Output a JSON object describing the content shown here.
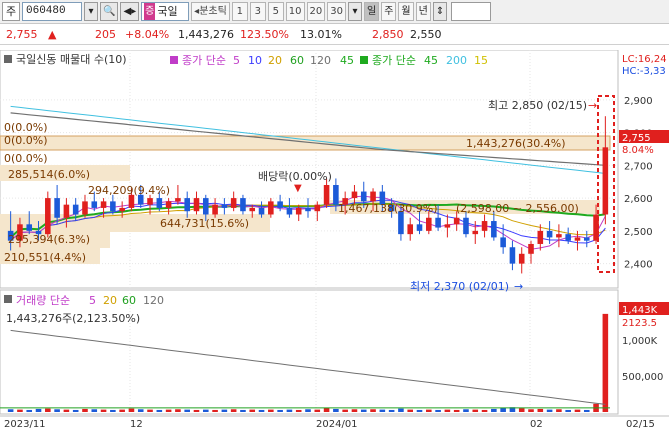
{
  "toolbar": {
    "market_label": "주",
    "stock_code": "060480",
    "stock_mark": "증",
    "stock_name": "국일",
    "menu_label": "◂분초틱",
    "intervals": [
      "1",
      "3",
      "5",
      "10",
      "20",
      "30"
    ],
    "selected_interval": "30",
    "periods": [
      "일",
      "주",
      "월",
      "년"
    ],
    "selected_period": "일"
  },
  "quote": {
    "price": "2,755",
    "change_arrow": "▲",
    "change": "205",
    "change_pct": "+8.04%",
    "volume": "1,443,276",
    "volume_ratio": "123.50%",
    "turnover": "13.01%",
    "high": "2,850",
    "open": "2,550"
  },
  "chart": {
    "legend_main_name": "국일신동 매물대 수(10)",
    "legend_ma_label": "종가 단순",
    "legend_ma_periods": [
      "5",
      "10",
      "20",
      "60",
      "120"
    ],
    "legend_ma2_label": "종가 단순",
    "legend_ma2_periods": [
      "45",
      "200",
      "15"
    ],
    "lc_label": "LC:16,24",
    "hc_label": "HC:-3,33",
    "y_ticks": [
      "2,900",
      "2,800",
      "2,700",
      "2,600",
      "2,500",
      "2,400"
    ],
    "last_price_box": "2,755",
    "last_pct_box": "8.04%",
    "vp_labels": [
      "0(0.0%)",
      "0(0.0%)",
      "0(0.0%)",
      "285,514(6.0%)",
      "294,209(9.4%)",
      "644,731(15.6%)",
      "295,394(6.3%)",
      "210,551(4.4%)",
      "1,443,276(30.4%)",
      "1,467,138(30.9%)"
    ],
    "range_label": "(2,598.00 ~ 2,556.00)",
    "dividend_label": "배당락(0.00%)",
    "high_label": "최고 2,850 (02/15)",
    "low_label": "최저 2,370 (02/01)",
    "volume_legend_label": "거래량 단순",
    "volume_legend_periods": [
      "5",
      "20",
      "60",
      "120"
    ],
    "volume_text": "1,443,276주(2,123.50%)",
    "volume_y_ticks": [
      "1,000K",
      "500,000"
    ],
    "volume_box": "1,443K",
    "volume_pct_box": "2123.5",
    "x_labels": [
      "2023/11",
      "12",
      "2024/01",
      "02",
      "02/15"
    ]
  },
  "chart_data": {
    "type": "candlestick",
    "y_range": [
      2350,
      2930
    ],
    "candles": [
      [
        2500,
        2560,
        2440,
        2470
      ],
      [
        2470,
        2540,
        2450,
        2520
      ],
      [
        2520,
        2560,
        2490,
        2500
      ],
      [
        2500,
        2530,
        2470,
        2490
      ],
      [
        2490,
        2620,
        2480,
        2600
      ],
      [
        2600,
        2640,
        2520,
        2540
      ],
      [
        2540,
        2600,
        2510,
        2580
      ],
      [
        2580,
        2600,
        2530,
        2550
      ],
      [
        2550,
        2610,
        2540,
        2590
      ],
      [
        2590,
        2620,
        2560,
        2570
      ],
      [
        2570,
        2600,
        2540,
        2590
      ],
      [
        2590,
        2610,
        2550,
        2560
      ],
      [
        2560,
        2590,
        2540,
        2570
      ],
      [
        2570,
        2630,
        2560,
        2610
      ],
      [
        2610,
        2640,
        2570,
        2580
      ],
      [
        2580,
        2610,
        2550,
        2600
      ],
      [
        2600,
        2620,
        2560,
        2570
      ],
      [
        2570,
        2600,
        2550,
        2590
      ],
      [
        2590,
        2640,
        2580,
        2600
      ],
      [
        2600,
        2620,
        2540,
        2560
      ],
      [
        2560,
        2620,
        2550,
        2600
      ],
      [
        2600,
        2610,
        2530,
        2550
      ],
      [
        2550,
        2600,
        2540,
        2580
      ],
      [
        2580,
        2600,
        2550,
        2570
      ],
      [
        2570,
        2620,
        2560,
        2600
      ],
      [
        2600,
        2610,
        2550,
        2560
      ],
      [
        2560,
        2580,
        2540,
        2570
      ],
      [
        2570,
        2590,
        2540,
        2550
      ],
      [
        2550,
        2600,
        2540,
        2590
      ],
      [
        2590,
        2610,
        2560,
        2570
      ],
      [
        2570,
        2600,
        2540,
        2550
      ],
      [
        2550,
        2580,
        2530,
        2570
      ],
      [
        2570,
        2600,
        2540,
        2560
      ],
      [
        2560,
        2590,
        2530,
        2580
      ],
      [
        2580,
        2660,
        2570,
        2640
      ],
      [
        2640,
        2660,
        2560,
        2580
      ],
      [
        2580,
        2620,
        2550,
        2600
      ],
      [
        2600,
        2640,
        2580,
        2620
      ],
      [
        2620,
        2650,
        2570,
        2590
      ],
      [
        2590,
        2630,
        2560,
        2620
      ],
      [
        2620,
        2640,
        2560,
        2580
      ],
      [
        2580,
        2600,
        2540,
        2560
      ],
      [
        2560,
        2580,
        2470,
        2490
      ],
      [
        2490,
        2540,
        2470,
        2520
      ],
      [
        2520,
        2560,
        2490,
        2500
      ],
      [
        2500,
        2560,
        2490,
        2540
      ],
      [
        2540,
        2580,
        2500,
        2510
      ],
      [
        2510,
        2550,
        2480,
        2520
      ],
      [
        2520,
        2560,
        2500,
        2540
      ],
      [
        2540,
        2560,
        2480,
        2490
      ],
      [
        2490,
        2530,
        2460,
        2500
      ],
      [
        2500,
        2550,
        2480,
        2530
      ],
      [
        2530,
        2560,
        2470,
        2480
      ],
      [
        2480,
        2520,
        2430,
        2450
      ],
      [
        2450,
        2470,
        2380,
        2400
      ],
      [
        2400,
        2450,
        2370,
        2430
      ],
      [
        2430,
        2470,
        2400,
        2460
      ],
      [
        2460,
        2520,
        2440,
        2500
      ],
      [
        2500,
        2530,
        2460,
        2480
      ],
      [
        2480,
        2520,
        2450,
        2490
      ],
      [
        2490,
        2510,
        2460,
        2470
      ],
      [
        2470,
        2500,
        2440,
        2480
      ],
      [
        2480,
        2500,
        2450,
        2470
      ],
      [
        2470,
        2580,
        2460,
        2550
      ],
      [
        2550,
        2850,
        2520,
        2755
      ]
    ],
    "volume_range": [
      0,
      1500000
    ],
    "volumes": [
      40,
      35,
      30,
      45,
      50,
      40,
      35,
      30,
      45,
      40,
      35,
      30,
      35,
      50,
      40,
      35,
      30,
      35,
      40,
      35,
      30,
      35,
      30,
      35,
      40,
      30,
      35,
      30,
      35,
      30,
      35,
      30,
      40,
      35,
      60,
      45,
      35,
      40,
      35,
      40,
      35,
      30,
      50,
      35,
      30,
      35,
      30,
      35,
      30,
      40,
      35,
      30,
      45,
      60,
      70,
      55,
      40,
      45,
      35,
      40,
      30,
      35,
      30,
      120,
      1443
    ]
  },
  "colors": {
    "up": "#e0201e",
    "down": "#1c5ad8",
    "ma5": "#c03cc8",
    "ma10": "#3c3cff",
    "ma20": "#d0a000",
    "ma60": "#20a020",
    "ma120": "#707070",
    "ma45": "#1faa1f",
    "ma200": "#40c0e0",
    "ma15": "#d0c000",
    "volume_profile": "#f5e6cc"
  }
}
